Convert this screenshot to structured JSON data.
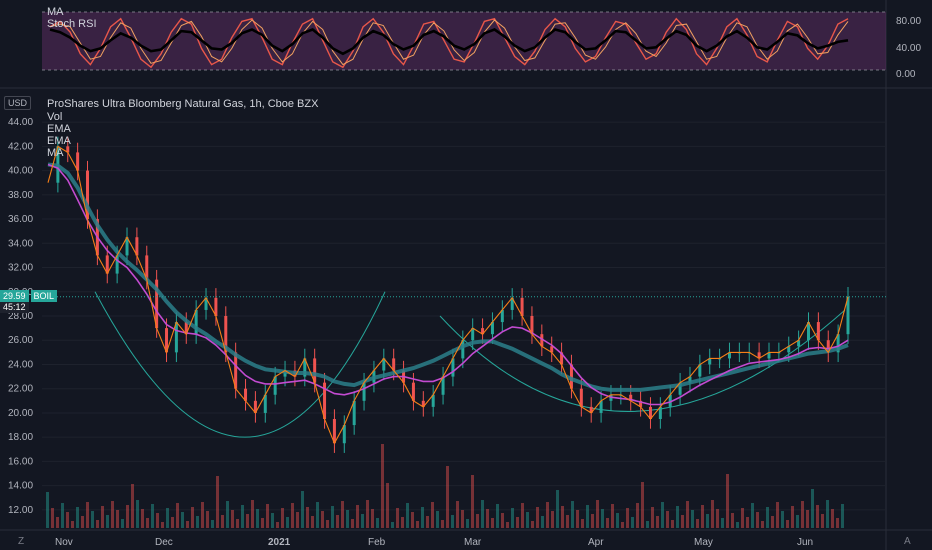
{
  "oscillator": {
    "labels": [
      "MA",
      "Stoch RSI"
    ],
    "y_ticks": [
      "80.00",
      "40.00",
      "0.00"
    ]
  },
  "main": {
    "title": "ProShares Ultra Bloomberg Natural Gas, 1h, Cboe BZX",
    "indicators": [
      "Vol",
      "EMA",
      "EMA",
      "MA"
    ],
    "currency": "USD",
    "price_label": "29.59",
    "symbol_label": "BOIL",
    "countdown": "45:12",
    "y_ticks": [
      "44.00",
      "42.00",
      "40.00",
      "38.00",
      "36.00",
      "34.00",
      "32.00",
      "30.00",
      "28.00",
      "26.00",
      "24.00",
      "22.00",
      "20.00",
      "18.00",
      "16.00",
      "14.00",
      "12.00"
    ],
    "x_labels": [
      {
        "text": "Nov",
        "bold": false
      },
      {
        "text": "Dec",
        "bold": false
      },
      {
        "text": "2021",
        "bold": true
      },
      {
        "text": "Feb",
        "bold": false
      },
      {
        "text": "Mar",
        "bold": false
      },
      {
        "text": "Apr",
        "bold": false
      },
      {
        "text": "May",
        "bold": false
      },
      {
        "text": "Jun",
        "bold": false
      }
    ],
    "corner_left": "Z",
    "corner_right": "A"
  },
  "chart_data": {
    "type": "line",
    "ylim": [
      11,
      45
    ],
    "price": [
      39,
      42,
      41.5,
      40,
      36,
      33,
      31.5,
      33,
      34.5,
      33,
      31,
      27,
      25,
      27.5,
      26.5,
      28.5,
      29.5,
      28,
      25,
      22,
      21,
      20,
      21.5,
      23,
      23.5,
      23,
      24.5,
      22.5,
      19.5,
      17.5,
      19,
      21,
      22.5,
      23.5,
      24.5,
      23.5,
      22.5,
      21,
      20.5,
      21.5,
      23,
      24.5,
      26,
      27,
      26.5,
      27.5,
      28.5,
      29.5,
      28,
      26.5,
      25.5,
      25,
      24,
      22,
      20.5,
      20,
      21,
      21.5,
      21.5,
      21,
      20.5,
      19.5,
      20.5,
      21.5,
      22.5,
      23,
      24,
      24.5,
      24.5,
      25,
      25,
      25,
      24.5,
      25,
      25,
      25.5,
      26,
      27.5,
      26,
      25,
      26.5,
      29.59
    ],
    "ema_teal": [
      40.5,
      40.4,
      39.8,
      38.6,
      37,
      35.5,
      34.3,
      33.3,
      32.5,
      31.8,
      31,
      30.2,
      29.2,
      28.3,
      27.6,
      27,
      26.5,
      25.9,
      25.4,
      24.8,
      24.3,
      23.9,
      23.6,
      23.5,
      23.4,
      23.3,
      23.3,
      23.2,
      23,
      22.6,
      22.4,
      22.3,
      22.6,
      22.9,
      23.1,
      23.3,
      23.5,
      23.7,
      24,
      24.3,
      24.7,
      25.1,
      25.5,
      25.8,
      25.9,
      25.9,
      25.6,
      25.3,
      24.9,
      24.5,
      24.1,
      23.7,
      23.2,
      22.8,
      22.5,
      22.2,
      22.0,
      21.9,
      21.9,
      21.9,
      21.9,
      22.0,
      22.1,
      22.2,
      22.3,
      22.5,
      22.7,
      22.9,
      23.1,
      23.3,
      23.5,
      23.7,
      23.9,
      24.1,
      24.3,
      24.5,
      24.7,
      24.9,
      25.0,
      25.1,
      25.3,
      25.6
    ],
    "ema_magenta": [
      40.5,
      40.2,
      39.2,
      37.6,
      35.9,
      34.5,
      33.4,
      32.6,
      32,
      31,
      29.8,
      28.4,
      27.3,
      26.8,
      26.6,
      26.5,
      26.2,
      25.6,
      24.8,
      23.9,
      23.1,
      22.6,
      22.4,
      22.4,
      22.5,
      22.6,
      22.7,
      22.4,
      22,
      21.6,
      21.5,
      21.7,
      22.0,
      22.4,
      22.8,
      23.0,
      23.0,
      22.8,
      22.6,
      22.6,
      22.9,
      23.4,
      24.1,
      24.9,
      25.5,
      26.1,
      26.7,
      27.1,
      27,
      26.6,
      26.1,
      25.6,
      24.9,
      23.9,
      22.9,
      22.1,
      21.6,
      21.3,
      21.2,
      21.1,
      20.9,
      20.7,
      20.7,
      20.9,
      21.3,
      21.8,
      22.3,
      22.7,
      23.1,
      23.5,
      23.8,
      24.1,
      24.2,
      24.3,
      24.4,
      24.6,
      24.9,
      25.3,
      25.4,
      25.3,
      25.5,
      26.0
    ],
    "osc_k": [
      80,
      90,
      70,
      30,
      10,
      40,
      80,
      95,
      60,
      20,
      5,
      30,
      70,
      95,
      85,
      40,
      10,
      20,
      60,
      90,
      95,
      60,
      20,
      10,
      50,
      85,
      95,
      55,
      15,
      5,
      35,
      80,
      95,
      70,
      30,
      10,
      45,
      85,
      90,
      55,
      20,
      15,
      50,
      90,
      95,
      60,
      25,
      10,
      35,
      75,
      95,
      80,
      40,
      15,
      25,
      60,
      90,
      85,
      50,
      20,
      30,
      70,
      95,
      75,
      30,
      10,
      40,
      80,
      95,
      65,
      25,
      15,
      55,
      90,
      80,
      40,
      20,
      45,
      85,
      95
    ],
    "osc_ma": [
      75,
      70,
      60,
      45,
      35,
      40,
      55,
      68,
      60,
      45,
      35,
      38,
      55,
      72,
      70,
      55,
      40,
      38,
      50,
      68,
      75,
      65,
      45,
      35,
      48,
      68,
      75,
      60,
      40,
      30,
      40,
      60,
      72,
      65,
      48,
      38,
      45,
      65,
      72,
      62,
      45,
      38,
      48,
      68,
      75,
      62,
      45,
      35,
      42,
      60,
      75,
      70,
      52,
      38,
      40,
      55,
      72,
      70,
      55,
      40,
      42,
      58,
      72,
      65,
      45,
      35,
      45,
      62,
      72,
      60,
      42,
      38,
      52,
      68,
      64,
      50,
      40,
      45,
      52,
      55
    ]
  }
}
